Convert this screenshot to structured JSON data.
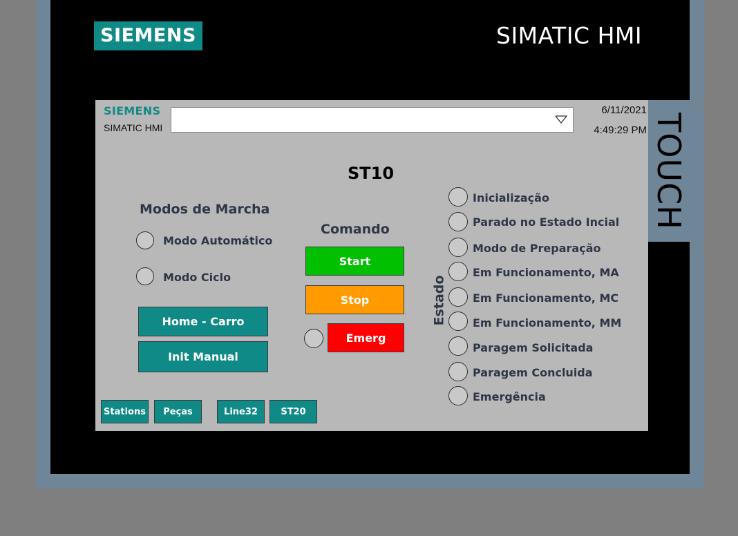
{
  "device": {
    "brand": "SIEMENS",
    "model": "SIMATIC HMI",
    "side_label": "TOUCH"
  },
  "header": {
    "logo": "SIEMENS",
    "subtitle": "SIMATIC HMI",
    "dropdown_value": "",
    "date": "6/11/2021",
    "time": "4:49:29 PM"
  },
  "station_title": "ST10",
  "modos": {
    "title": "Modos de Marcha",
    "items": [
      "Modo Automático",
      "Modo Ciclo"
    ],
    "buttons": [
      "Home - Carro",
      "Init Manual"
    ]
  },
  "comando": {
    "title": "Comando",
    "start": "Start",
    "stop": "Stop",
    "emerg": "Emerg"
  },
  "estado": {
    "title": "Estado",
    "items": [
      "Inicialização",
      "Parado no Estado Incial",
      "Modo de Preparação",
      "Em Funcionamento, MA",
      "Em Funcionamento, MC",
      "Em Funcionamento, MM",
      "Paragem Solicitada",
      "Paragem Concluida",
      "Emergência"
    ]
  },
  "nav": [
    "Stations",
    "Peças",
    "Line32",
    "ST20"
  ],
  "colors": {
    "teal": "#0f8a86",
    "start": "#00c000",
    "stop": "#ff9a00",
    "emerg": "#ff0000",
    "screen_bg": "#b8b8b8"
  }
}
